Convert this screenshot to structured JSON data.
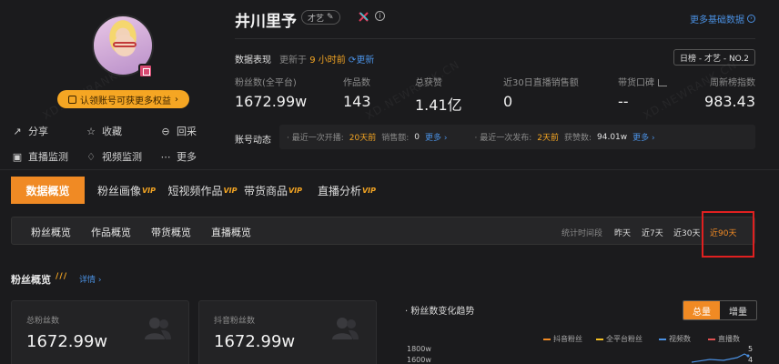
{
  "profile": {
    "claim_label": "认领账号可获更多权益",
    "actions": [
      {
        "icon": "share-icon",
        "label": "分享"
      },
      {
        "icon": "star-icon",
        "label": "收藏"
      },
      {
        "icon": "collect-icon",
        "label": "回采"
      },
      {
        "icon": "live-monitor-icon",
        "label": "直播监测"
      },
      {
        "icon": "video-monitor-icon",
        "label": "视频监测"
      },
      {
        "icon": "more-icon",
        "label": "更多"
      }
    ]
  },
  "header": {
    "name": "井川里予",
    "tag": "才艺",
    "more_basic": "更多基础数据",
    "info_icon": "info-icon",
    "platform_icon": "douyin-icon"
  },
  "performance": {
    "label": "数据表现",
    "update_prefix": "更新于",
    "update_time": "9 小时前",
    "refresh_label": "更新",
    "rank_chip": "日榜 - 才艺 - NO.2",
    "stats": [
      {
        "label": "粉丝数(全平台)",
        "value": "1672.99w"
      },
      {
        "label": "作品数",
        "value": "143"
      },
      {
        "label": "总获赞",
        "value": "1.41亿"
      },
      {
        "label": "近30日直播销售额",
        "value": "0"
      },
      {
        "label": "带货口碑",
        "value": "--"
      },
      {
        "label": "周新榜指数",
        "value": "983.43"
      }
    ]
  },
  "dynamics": {
    "label": "账号动态",
    "live_prefix": "· 最近一次开播:",
    "live_days": "20天前",
    "sales_prefix": "销售额:",
    "sales_value": "0",
    "live_more": "更多 ›",
    "post_prefix": "· 最近一次发布:",
    "post_days": "2天前",
    "likes_prefix": "获赞数:",
    "likes_value": "94.01w",
    "post_more": "更多 ›"
  },
  "main_tabs": [
    {
      "label": "数据概览",
      "vip": ""
    },
    {
      "label": "粉丝画像",
      "vip": "VIP"
    },
    {
      "label": "短视频作品",
      "vip": "VIP"
    },
    {
      "label": "带货商品",
      "vip": "VIP"
    },
    {
      "label": "直播分析",
      "vip": "VIP"
    }
  ],
  "sub_tabs": [
    "粉丝概览",
    "作品概览",
    "带货概览",
    "直播概览"
  ],
  "period": {
    "label": "统计时间段",
    "options": [
      "昨天",
      "近7天",
      "近30天",
      "近90天"
    ],
    "active": "近90天"
  },
  "fans": {
    "title": "粉丝概览",
    "detail_link": "详情 ›",
    "cards": [
      {
        "label": "总粉丝数",
        "value": "1672.99w",
        "icon": "people-icon"
      },
      {
        "label": "抖音粉丝数",
        "value": "1672.99w",
        "icon": "people-icon"
      }
    ]
  },
  "trend": {
    "title": "· 粉丝数变化趋势",
    "toggle": [
      "总量",
      "增量"
    ],
    "legend": [
      {
        "label": "抖音粉丝",
        "color": "#f08a24"
      },
      {
        "label": "全平台粉丝",
        "color": "#f5c023"
      },
      {
        "label": "视频数",
        "color": "#4a90e2"
      },
      {
        "label": "直播数",
        "color": "#e05050"
      }
    ],
    "y_ticks": [
      "1800w",
      "1600w"
    ],
    "right_ticks": [
      "5",
      "4"
    ]
  },
  "colors": {
    "accent": "#f08a24",
    "link": "#4a90e2",
    "background": "#1b1b1d"
  },
  "watermarks": [
    "XD.NEWRANK.CN",
    "XD.NEWRANK.CN",
    "XD.NEWRANK.CN"
  ]
}
